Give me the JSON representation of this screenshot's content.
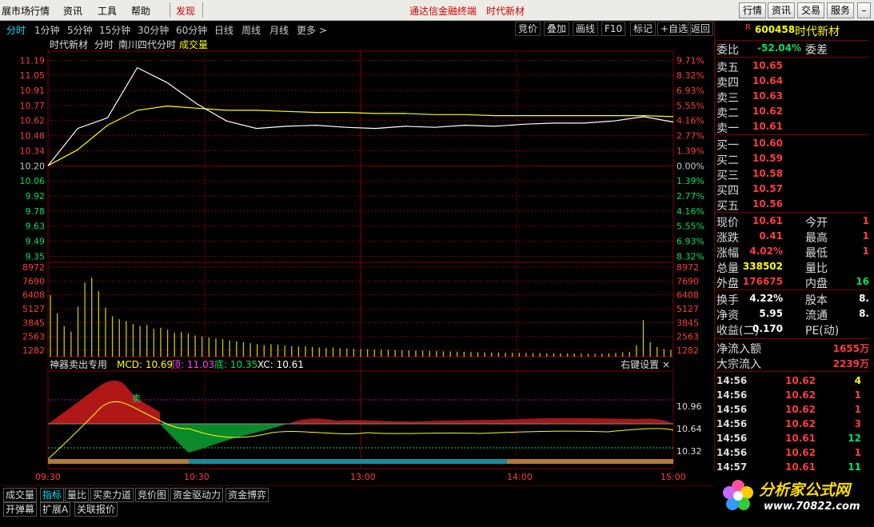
{
  "menu": {
    "items": [
      "展市场行情",
      "资讯",
      "工具",
      "帮助"
    ],
    "discover": "发现",
    "title": "通达信金融终端　时代新材",
    "right_buttons": [
      "行情",
      "资讯",
      "交易",
      "服务"
    ]
  },
  "toolbar": {
    "tabs": [
      "分时",
      "1分钟",
      "5分钟",
      "15分钟",
      "30分钟",
      "60分钟",
      "日线",
      "周线",
      "月线",
      "更多 >"
    ],
    "active": "分时",
    "right_buttons": [
      "竞价",
      "叠加",
      "画线",
      "F10",
      "标记",
      "+自选",
      "返回"
    ]
  },
  "chart": {
    "header": {
      "name": "时代新材",
      "period": "分时",
      "indicator": "南川四代分时",
      "vol": "成交量"
    },
    "price_labels": [
      "11.19",
      "11.05",
      "10.91",
      "10.77",
      "10.62",
      "10.48",
      "10.34",
      "10.20",
      "10.06",
      "9.92",
      "9.78",
      "9.63",
      "9.49",
      "9.35"
    ],
    "pct_labels": [
      "9.71%",
      "8.32%",
      "6.93%",
      "5.55%",
      "4.16%",
      "2.77%",
      "1.39%",
      "0.00%",
      "1.39%",
      "2.77%",
      "4.16%",
      "5.55%",
      "6.93%",
      "8.32%"
    ],
    "vol_labels": [
      "8972",
      "7690",
      "6408",
      "5127",
      "3845",
      "2563",
      "1282"
    ],
    "indicator_header": {
      "name": "神器卖出专用",
      "mcd": "MCD: 10.69",
      "top": "顶: 11.03",
      "bottom": "底: 10.35",
      "xc": "XC: 10.61",
      "settings": "右键设置 ×",
      "sell_mark": "卖"
    },
    "ind_labels": [
      "10.96",
      "10.64",
      "10.32"
    ],
    "time_labels": [
      "09:30",
      "10:30",
      "13:00",
      "14:00",
      "15:00"
    ],
    "colors": {
      "price_line": "#ffffff",
      "avg_line": "#ffff00",
      "volume": "#c8c800",
      "grid": "#800000",
      "red": "#ff3c3c",
      "green": "#00e060"
    }
  },
  "chart_data": {
    "type": "line",
    "title": "时代新材 分时",
    "x": [
      "09:30",
      "10:30",
      "13:00",
      "14:00",
      "15:00"
    ],
    "series": [
      {
        "name": "price",
        "values": [
          10.2,
          10.55,
          10.65,
          11.12,
          10.98,
          10.78,
          10.62,
          10.55,
          10.57,
          10.58,
          10.56,
          10.55,
          10.57,
          10.56,
          10.58,
          10.57,
          10.59,
          10.6,
          10.6,
          10.62,
          10.66,
          10.61
        ]
      },
      {
        "name": "avg",
        "values": [
          10.2,
          10.35,
          10.58,
          10.72,
          10.76,
          10.74,
          10.72,
          10.72,
          10.71,
          10.7,
          10.7,
          10.69,
          10.69,
          10.68,
          10.68,
          10.67,
          10.67,
          10.67,
          10.67,
          10.67,
          10.67,
          10.66
        ]
      }
    ],
    "ylim": [
      9.35,
      11.19
    ],
    "volume": [
      6400,
      4500,
      3200,
      2600,
      5200,
      7700,
      8200,
      6800,
      5100,
      4200,
      3900,
      3700,
      3400,
      3200,
      3300,
      2900,
      3000,
      2800,
      2500,
      2600,
      2400,
      2200,
      2100,
      2000,
      1900,
      1800,
      1700,
      1600,
      1500,
      1400,
      1300,
      1200,
      1300,
      1250,
      1150,
      1100,
      1050,
      1100,
      1000,
      950,
      900,
      950,
      880,
      850,
      820,
      800,
      780,
      760,
      740,
      720,
      700,
      680,
      660,
      640,
      620,
      600,
      580,
      560,
      540,
      520,
      500,
      480,
      460,
      450,
      440,
      430,
      420,
      410,
      400,
      390,
      380,
      370,
      360,
      350,
      340,
      330,
      320,
      310,
      300,
      300,
      300,
      350,
      400,
      450,
      500,
      1200,
      3800,
      1500,
      1000,
      800,
      700
    ]
  },
  "right_panel": {
    "code": "600458",
    "name": "时代新材",
    "webi_label": "委比",
    "webi_val": "-52.04%",
    "weicha_label": "委差",
    "sells": [
      {
        "label": "卖五",
        "price": "10.65"
      },
      {
        "label": "卖四",
        "price": "10.64"
      },
      {
        "label": "卖三",
        "price": "10.63"
      },
      {
        "label": "卖二",
        "price": "10.62"
      },
      {
        "label": "卖一",
        "price": "10.61"
      }
    ],
    "buys": [
      {
        "label": "买一",
        "price": "10.60"
      },
      {
        "label": "买二",
        "price": "10.59"
      },
      {
        "label": "买三",
        "price": "10.58"
      },
      {
        "label": "买四",
        "price": "10.57"
      },
      {
        "label": "买五",
        "price": "10.56"
      }
    ],
    "stats": [
      {
        "l1": "现价",
        "v1": "10.61",
        "l2": "今开",
        "v2": "1"
      },
      {
        "l1": "涨跌",
        "v1": "0.41",
        "l2": "最高",
        "v2": "1"
      },
      {
        "l1": "涨幅",
        "v1": "4.02%",
        "l2": "最低",
        "v2": "1"
      },
      {
        "l1": "总量",
        "v1": "338502",
        "l2": "量比",
        "v2": ""
      },
      {
        "l1": "外盘",
        "v1": "176675",
        "l2": "内盘",
        "v2": "16"
      }
    ],
    "stats2": [
      {
        "l1": "换手",
        "v1": "4.22%",
        "l2": "股本",
        "v2": "8."
      },
      {
        "l1": "净资",
        "v1": "5.95",
        "l2": "流通",
        "v2": "8."
      },
      {
        "l1": "收益(二)",
        "v1": "0.170",
        "l2": "PE(动)",
        "v2": ""
      }
    ],
    "flow": [
      {
        "label": "净流入额",
        "value": "1655万"
      },
      {
        "label": "大宗流入",
        "value": "2239万"
      }
    ],
    "ticks": [
      {
        "t": "14:56",
        "p": "10.62",
        "v": "4",
        "c": "yellow"
      },
      {
        "t": "14:56",
        "p": "10.62",
        "v": "1",
        "c": "red"
      },
      {
        "t": "14:56",
        "p": "10.62",
        "v": "1",
        "c": "red"
      },
      {
        "t": "14:56",
        "p": "10.62",
        "v": "3",
        "c": "red"
      },
      {
        "t": "14:56",
        "p": "10.61",
        "v": "12",
        "c": "green"
      },
      {
        "t": "14:56",
        "p": "10.62",
        "v": "1",
        "c": "red"
      },
      {
        "t": "14:57",
        "p": "10.61",
        "v": "11",
        "c": "green"
      }
    ]
  },
  "bottom_tabs": {
    "row1": [
      "成交量",
      "指标",
      "量比",
      "买卖力道",
      "竞价图",
      "资金驱动力",
      "资金博弈"
    ],
    "row2": [
      "开弹幕",
      "扩展A",
      "关联报价"
    ],
    "active": "指标"
  },
  "logo": {
    "text": "分析家公式网",
    "url": "www.70822.com"
  }
}
